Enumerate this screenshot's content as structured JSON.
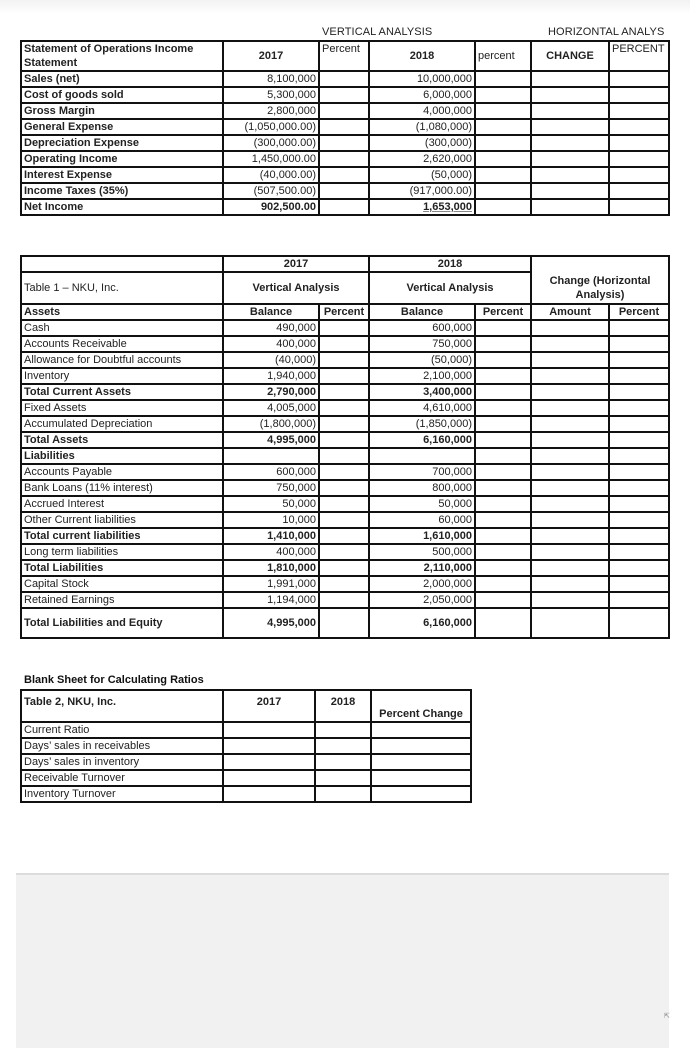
{
  "section_headers": {
    "vertical": "VERTICAL ANALYSIS",
    "horizontal": "HORIZONTAL ANALYS"
  },
  "income_statement": {
    "headers": {
      "title": "Statement of Operations  Income Statement",
      "y2017": "2017",
      "pct1": "Percent",
      "y2018": "2018",
      "pct2": "percent",
      "change": "CHANGE",
      "percent": "PERCENT"
    },
    "rows": [
      {
        "label": "Sales (net)",
        "v2017": "8,100,000",
        "v2018": "10,000,000"
      },
      {
        "label": "Cost of goods sold",
        "v2017": "5,300,000",
        "v2018": "6,000,000"
      },
      {
        "label": "Gross Margin",
        "v2017": "2,800,000",
        "v2018": "4,000,000"
      },
      {
        "label": "General Expense",
        "v2017": "(1,050,000.00)",
        "v2018": "(1,080,000)"
      },
      {
        "label": "Depreciation Expense",
        "v2017": "(300,000.00)",
        "v2018": "(300,000)"
      },
      {
        "label": "Operating Income",
        "v2017": "1,450,000.00",
        "v2018": "2,620,000"
      },
      {
        "label": "Interest Expense",
        "v2017": "(40,000.00)",
        "v2018": "(50,000)"
      },
      {
        "label": "Income Taxes (35%)",
        "v2017": "(507,500.00)",
        "v2018": "(917,000.00)"
      },
      {
        "label": "Net Income",
        "v2017": "902,500.00",
        "v2018": "1,653,000"
      }
    ]
  },
  "balance_sheet": {
    "year_2017": "2017",
    "year_2018": "2018",
    "title": "Table 1 – NKU, Inc.",
    "vertical_2017": "Vertical  Analysis",
    "vertical_2018": "Vertical  Analysis",
    "change_header": "Change (Horizontal Analysis)",
    "col_balance": "Balance",
    "col_percent": "Percent",
    "col_amount": "Amount",
    "col_percent_h": "Percent",
    "assets_label": "Assets",
    "rows": [
      {
        "label": "Cash",
        "v2017": "490,000",
        "v2018": "600,000"
      },
      {
        "label": "Accounts Receivable",
        "v2017": "400,000",
        "v2018": "750,000"
      },
      {
        "label": "Allowance for Doubtful accounts",
        "v2017": "(40,000)",
        "v2018": "(50,000)"
      },
      {
        "label": "Inventory",
        "v2017": "1,940,000",
        "v2018": "2,100,000"
      },
      {
        "label": "Total Current Assets",
        "v2017": "2,790,000",
        "v2018": "3,400,000"
      },
      {
        "label": "Fixed Assets",
        "v2017": "4,005,000",
        "v2018": "4,610,000"
      },
      {
        "label": "Accumulated Depreciation",
        "v2017": "(1,800,000)",
        "v2018": "(1,850,000)"
      },
      {
        "label": "Total Assets",
        "v2017": "4,995,000",
        "v2018": "6,160,000"
      },
      {
        "label": "Liabilities",
        "v2017": "",
        "v2018": ""
      },
      {
        "label": "Accounts Payable",
        "v2017": "600,000",
        "v2018": "700,000"
      },
      {
        "label": "Bank Loans (11% interest)",
        "v2017": "750,000",
        "v2018": "800,000"
      },
      {
        "label": "Accrued Interest",
        "v2017": "50,000",
        "v2018": "50,000"
      },
      {
        "label": "Other Current liabilities",
        "v2017": "10,000",
        "v2018": "60,000"
      },
      {
        "label": "Total current liabilities",
        "v2017": "1,410,000",
        "v2018": "1,610,000"
      },
      {
        "label": "Long term liabilities",
        "v2017": "400,000",
        "v2018": "500,000"
      },
      {
        "label": "Total Liabilities",
        "v2017": "1,810,000",
        "v2018": "2,110,000"
      },
      {
        "label": "Capital Stock",
        "v2017": "1,991,000",
        "v2018": "2,000,000"
      },
      {
        "label": "Retained Earnings",
        "v2017": "1,194,000",
        "v2018": "2,050,000"
      },
      {
        "label": "Total Liabilities and Equity",
        "v2017": "4,995,000",
        "v2018": "6,160,000"
      }
    ]
  },
  "ratios": {
    "sheet_title": "Blank Sheet for Calculating Ratios",
    "title": "Table 2, NKU, Inc.",
    "col_2017": "2017",
    "col_2018": "2018",
    "col_change": "Percent Change",
    "rows": [
      "Current Ratio",
      "Days’ sales in receivables",
      "Days’ sales in inventory",
      "Receivable Turnover",
      "Inventory Turnover"
    ]
  }
}
